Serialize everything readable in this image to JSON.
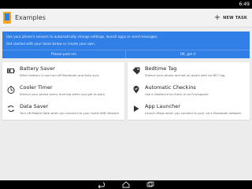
{
  "status_bar": {
    "time": "6:49"
  },
  "action_bar": {
    "title": "Examples",
    "new_task_label": "NEW TASK"
  },
  "banner": {
    "line1": "Use your phone's sensors to automatically change settings, launch apps or send messages.",
    "line2": "Get started with your tasks below or create your own.",
    "button_left": "Please post em",
    "button_right": "OK, got it"
  },
  "cards": [
    {
      "title": "Battery Saver",
      "desc": "When battery is low turn off Bluetooth and Auto sync",
      "icon": "battery-icon"
    },
    {
      "title": "Bedtime Tag",
      "desc": "Silence your phone and set an alarm with an NFC tag",
      "icon": "tag-icon"
    },
    {
      "title": "Cooler Timer",
      "desc": "Silence your phone every morning when you get to work",
      "icon": "timer-icon"
    },
    {
      "title": "Automatic Checkins",
      "desc": "Use a Geofence to check-in on Foursquare",
      "icon": "checkin-icon"
    },
    {
      "title": "Data Saver",
      "desc": "Turn off Mobile Data when you connect to your home Wifi network",
      "icon": "sync-icon"
    },
    {
      "title": "App Launcher",
      "desc": "Launch Maps when you connect to your car's Bluetooth network",
      "icon": "launch-icon"
    }
  ],
  "colors": {
    "banner": "#2f7fe6",
    "background": "#ececec",
    "card": "#ffffff"
  }
}
